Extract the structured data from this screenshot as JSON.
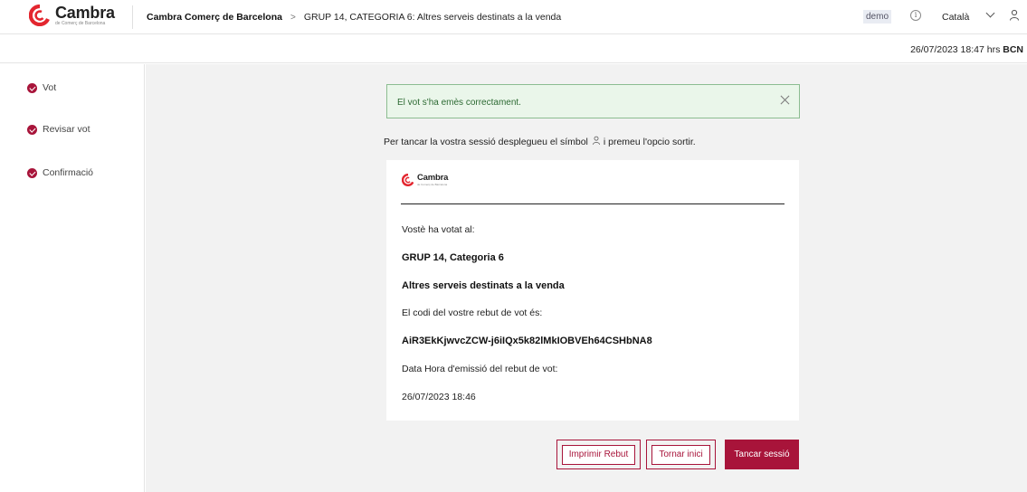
{
  "header": {
    "logo_name": "Cambra",
    "logo_sub": "de Comerç de Barcelona",
    "breadcrumb_org": "Cambra Comerç de Barcelona",
    "breadcrumb_sep": ">",
    "breadcrumb_category": "GRUP 14, CATEGORIA 6: Altres serveis destinats a la venda",
    "demo_badge": "demo",
    "info_icon": "i",
    "language": "Català"
  },
  "datebar": {
    "datetime": "26/07/2023 18:47 hrs",
    "zone": "BCN"
  },
  "sidebar": {
    "steps": [
      {
        "label": "Vot",
        "icon": "check-circle-icon"
      },
      {
        "label": "Revisar vot",
        "icon": "check-circle-icon"
      },
      {
        "label": "Confirmació",
        "icon": "check-circle-icon"
      }
    ]
  },
  "main": {
    "alert_text": "El vot s'ha emès correctament.",
    "instruction_before": "Per tancar la vostra sessió desplegueu el símbol",
    "instruction_after": "i premeu l'opcio sortir.",
    "receipt": {
      "logo_name": "Cambra",
      "logo_sub": "de Comerç de Barcelona",
      "voted_label": "Vostè ha votat al:",
      "group": "GRUP 14, Categoria 6",
      "category": "Altres serveis destinats a la venda",
      "code_label": "El codi del vostre rebut de vot és:",
      "code": "AiR3EkKjwvcZCW-j6iIQx5k82lMkIOBVEh64CSHbNA8",
      "date_label": "Data Hora d'emissió del rebut de vot:",
      "date": "26/07/2023 18:46"
    },
    "buttons": {
      "print": "Imprimir Rebut",
      "home": "Tornar inici",
      "logout": "Tancar sessió"
    }
  },
  "colors": {
    "brand": "#a8143a",
    "alert_border": "#8cbd91",
    "alert_bg": "#eaf6ea",
    "main_bg": "#f2f2f2"
  }
}
